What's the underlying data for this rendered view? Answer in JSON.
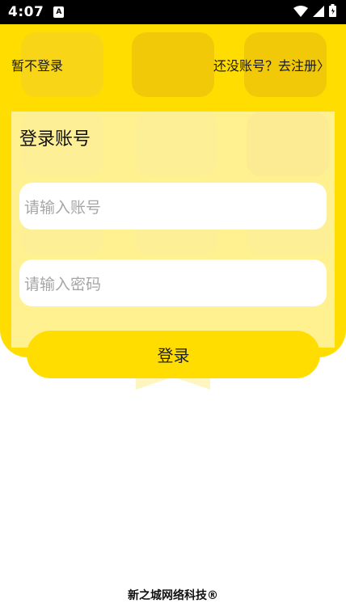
{
  "status_bar": {
    "time": "4:07",
    "app_icon_letter": "A",
    "icons": [
      "wifi-icon",
      "signal-icon",
      "battery-icon"
    ]
  },
  "header": {
    "skip_login": "暂不登录",
    "register_link": "还没账号？去注册",
    "register_chevron": "〉",
    "background_color": "#FFDD00"
  },
  "login_form": {
    "title": "登录账号",
    "account_placeholder": "请输入账号",
    "password_placeholder": "请输入密码",
    "login_button": "登录"
  },
  "footer": {
    "copyright": "新之城网络科技®"
  }
}
